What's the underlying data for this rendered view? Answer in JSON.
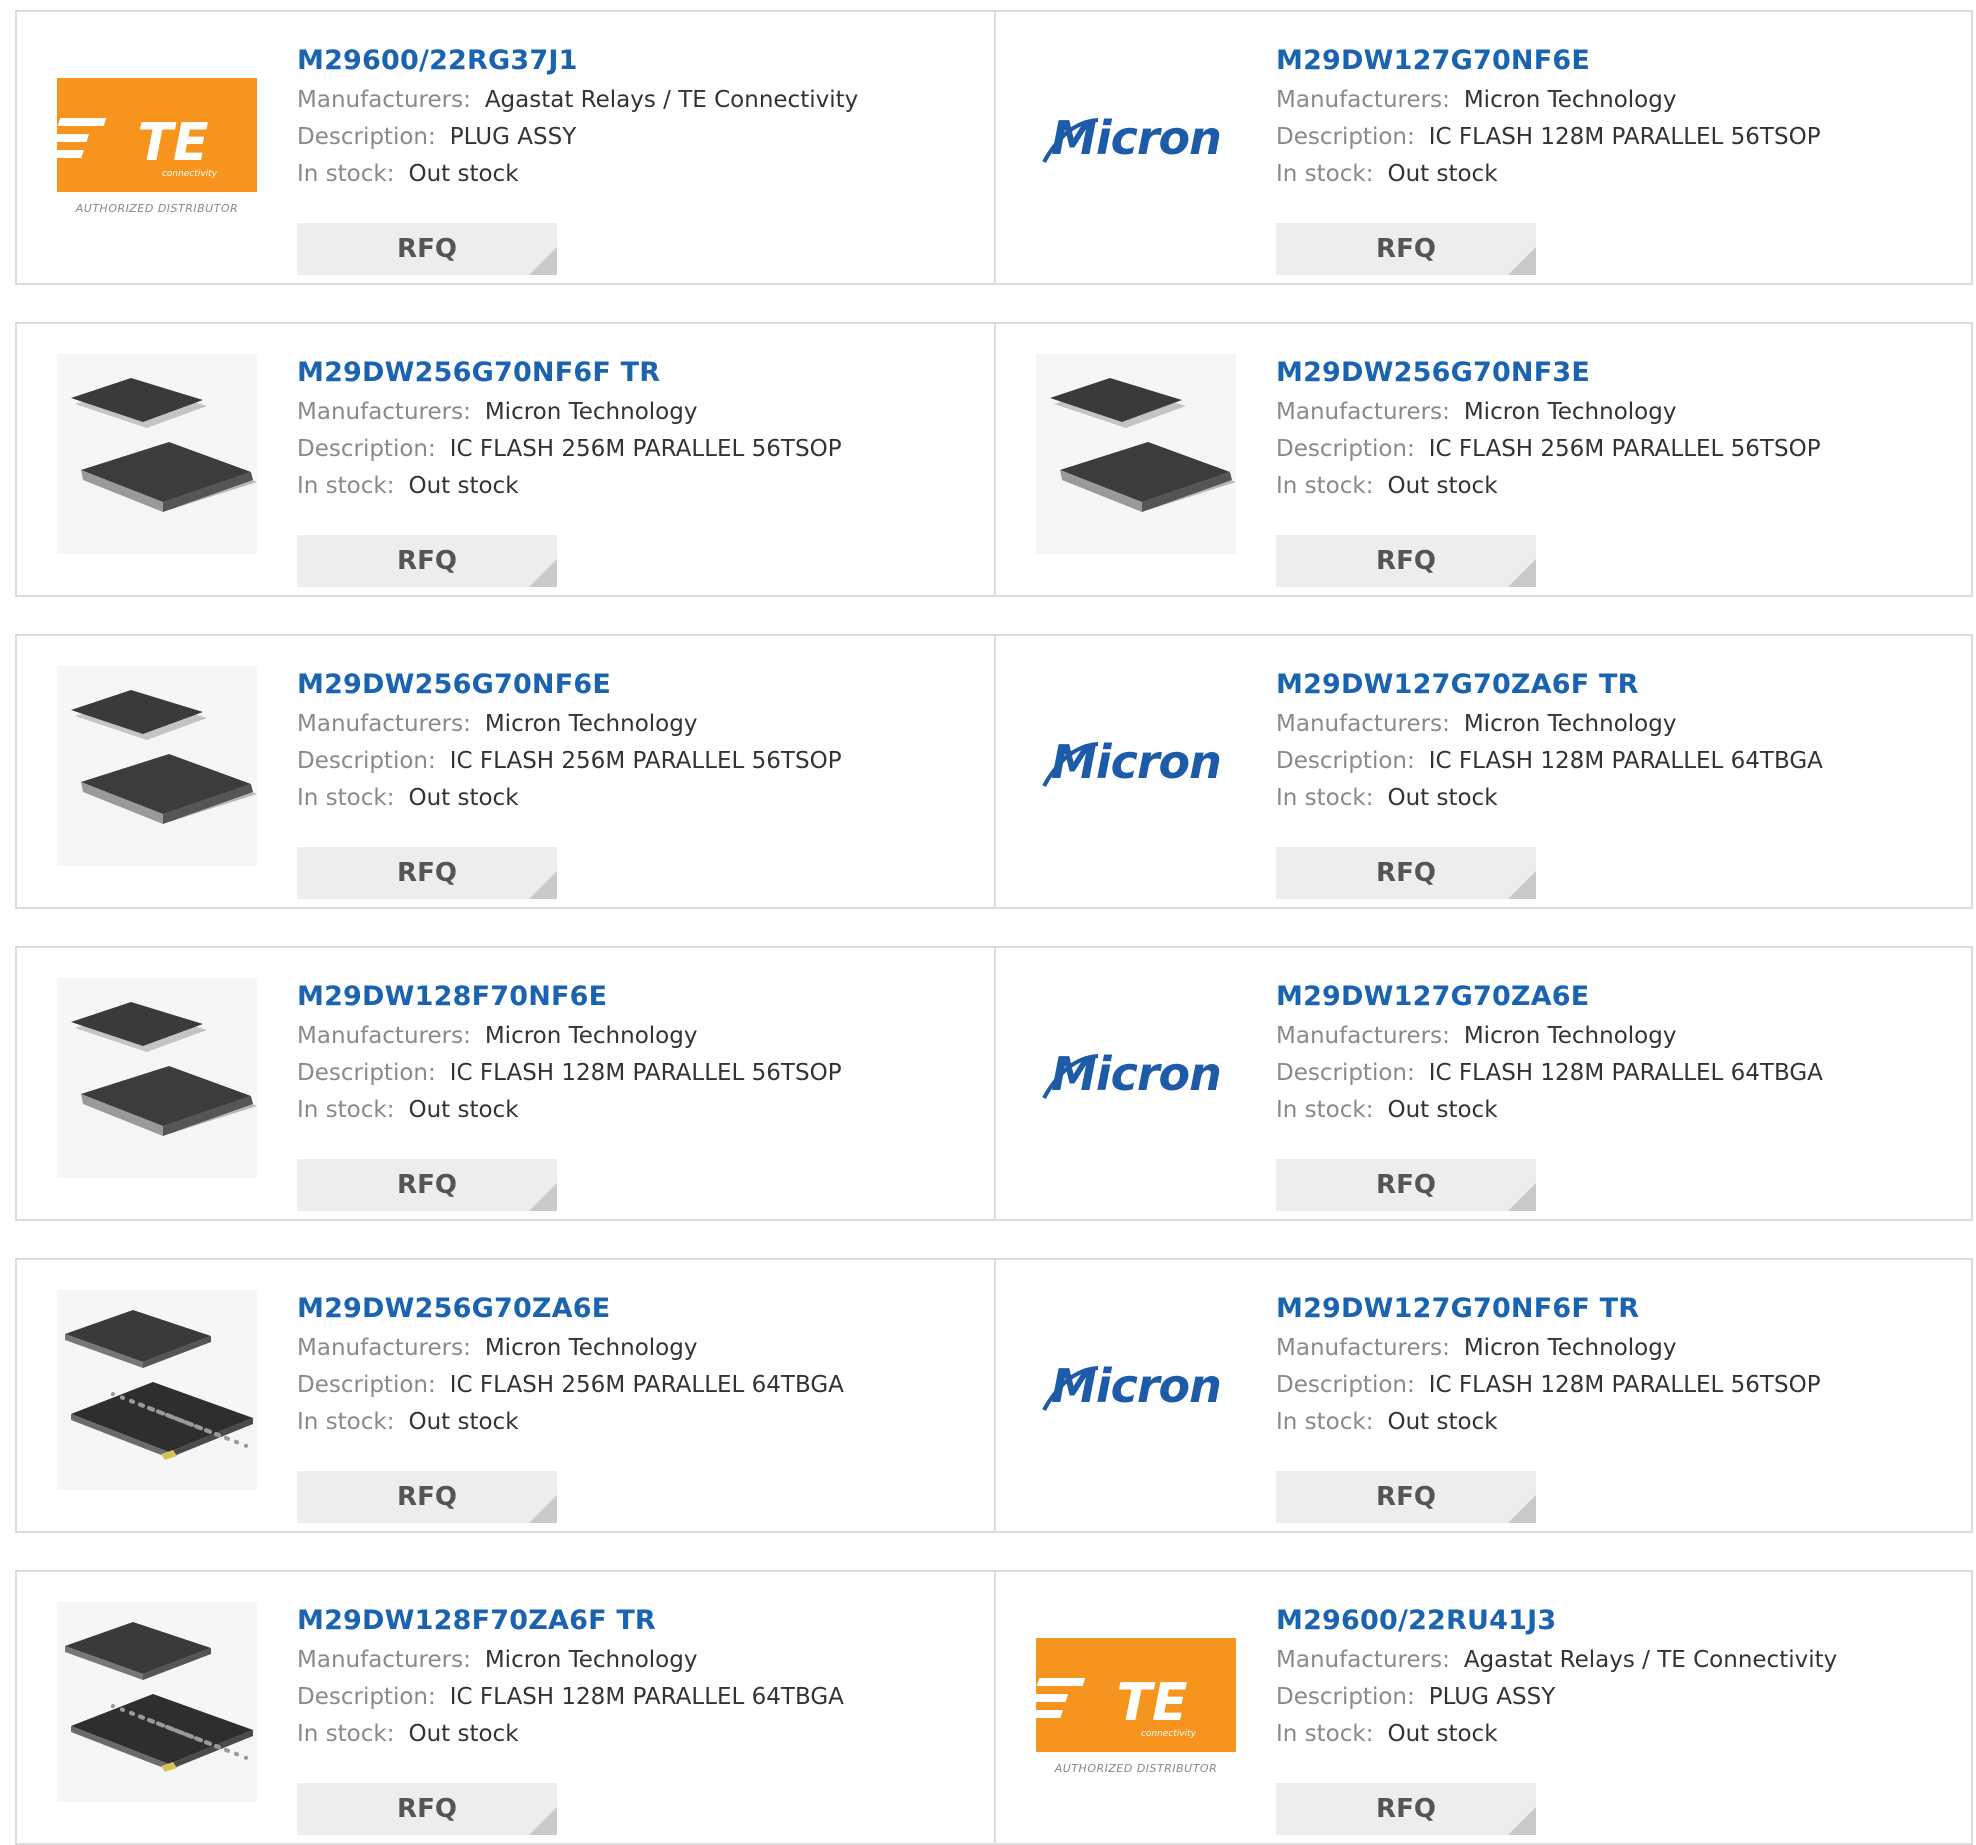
{
  "labels": {
    "manufacturers": "Manufacturers:",
    "description": "Description:",
    "stock": "In stock:",
    "rfq": "RFQ"
  },
  "colors": {
    "part_link": "#1a63b0",
    "te_orange": "#f7941d",
    "micron_blue": "#1d5aa8",
    "border": "#dcdcdc",
    "rfq_bg": "#ededed"
  },
  "logos": {
    "te_text": "TE",
    "te_sub": "connectivity",
    "te_tagline": "AUTHORIZED DISTRIBUTOR",
    "micron_text": "Micron"
  },
  "products": [
    {
      "part": "M29600/22RG37J1",
      "manufacturer": "Agastat Relays / TE Connectivity",
      "description": "PLUG ASSY",
      "stock": "Out stock",
      "image": "te-logo"
    },
    {
      "part": "M29DW127G70NF6E",
      "manufacturer": "Micron Technology",
      "description": "IC FLASH 128M PARALLEL 56TSOP",
      "stock": "Out stock",
      "image": "micron-logo"
    },
    {
      "part": "M29DW256G70NF6F TR",
      "manufacturer": "Micron Technology",
      "description": "IC FLASH 256M PARALLEL 56TSOP",
      "stock": "Out stock",
      "image": "tsop-chip"
    },
    {
      "part": "M29DW256G70NF3E",
      "manufacturer": "Micron Technology",
      "description": "IC FLASH 256M PARALLEL 56TSOP",
      "stock": "Out stock",
      "image": "tsop-chip"
    },
    {
      "part": "M29DW256G70NF6E",
      "manufacturer": "Micron Technology",
      "description": "IC FLASH 256M PARALLEL 56TSOP",
      "stock": "Out stock",
      "image": "tsop-chip"
    },
    {
      "part": "M29DW127G70ZA6F TR",
      "manufacturer": "Micron Technology",
      "description": "IC FLASH 128M PARALLEL 64TBGA",
      "stock": "Out stock",
      "image": "micron-logo"
    },
    {
      "part": "M29DW128F70NF6E",
      "manufacturer": "Micron Technology",
      "description": "IC FLASH 128M PARALLEL 56TSOP",
      "stock": "Out stock",
      "image": "tsop-chip"
    },
    {
      "part": "M29DW127G70ZA6E",
      "manufacturer": "Micron Technology",
      "description": "IC FLASH 128M PARALLEL 64TBGA",
      "stock": "Out stock",
      "image": "micron-logo"
    },
    {
      "part": "M29DW256G70ZA6E",
      "manufacturer": "Micron Technology",
      "description": "IC FLASH 256M PARALLEL 64TBGA",
      "stock": "Out stock",
      "image": "bga-chip"
    },
    {
      "part": "M29DW127G70NF6F TR",
      "manufacturer": "Micron Technology",
      "description": "IC FLASH 128M PARALLEL 56TSOP",
      "stock": "Out stock",
      "image": "micron-logo"
    },
    {
      "part": "M29DW128F70ZA6F TR",
      "manufacturer": "Micron Technology",
      "description": "IC FLASH 128M PARALLEL 64TBGA",
      "stock": "Out stock",
      "image": "bga-chip"
    },
    {
      "part": "M29600/22RU41J3",
      "manufacturer": "Agastat Relays / TE Connectivity",
      "description": "PLUG ASSY",
      "stock": "Out stock",
      "image": "te-logo"
    }
  ]
}
